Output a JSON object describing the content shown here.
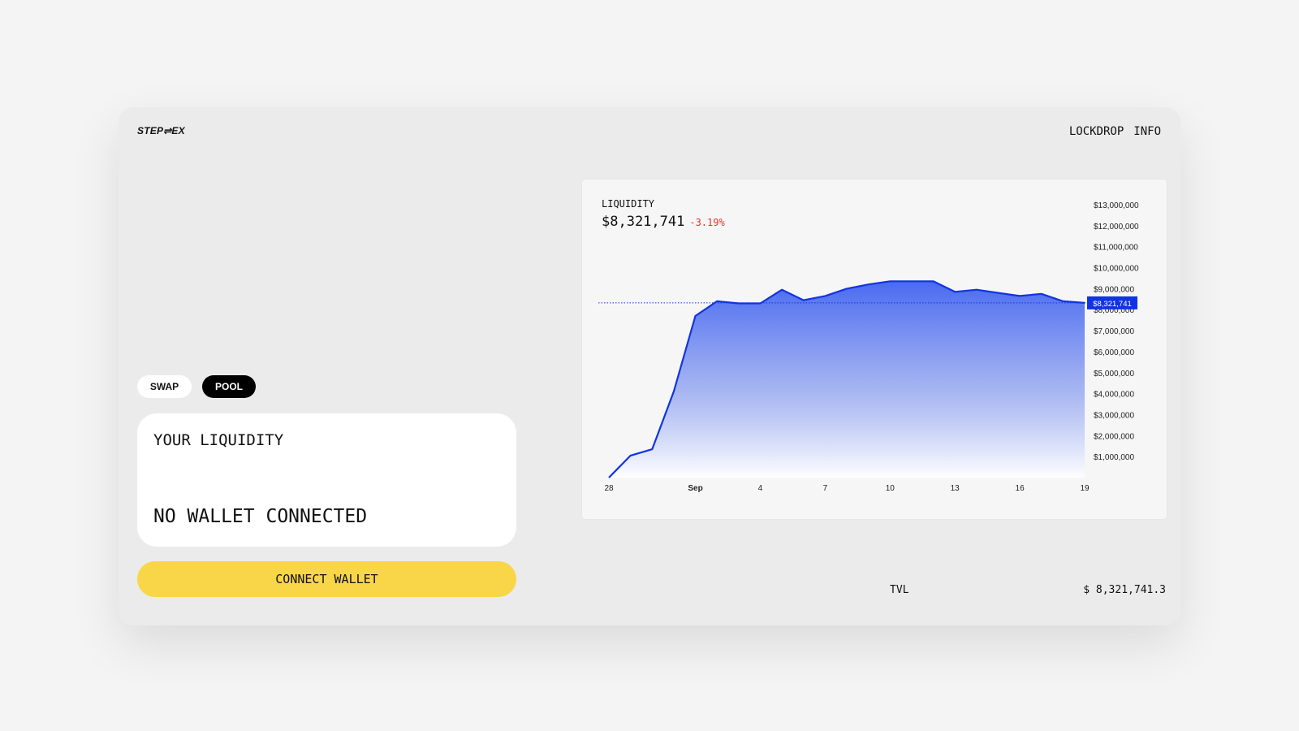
{
  "app": {
    "logo": "STEP⇌EX"
  },
  "nav": {
    "items": [
      "LOCKDROP",
      "INFO"
    ]
  },
  "tabs": {
    "swap": "SWAP",
    "pool": "POOL"
  },
  "liquidity_card": {
    "title": "YOUR LIQUIDITY",
    "status": "NO WALLET CONNECTED"
  },
  "connect_button": "CONNECT WALLET",
  "chart_panel": {
    "label": "LIQUIDITY",
    "value": "$8,321,741",
    "change": "-3.19%",
    "current_tag": "$8,321,741"
  },
  "tvl": {
    "label": "TVL",
    "value": "$ 8,321,741.3"
  },
  "colors": {
    "accent_yellow": "#f8d648",
    "line_blue": "#1134e0",
    "negative_red": "#e5322d"
  },
  "chart_data": {
    "type": "area",
    "x_tick_labels": [
      "28",
      "Sep",
      "4",
      "7",
      "10",
      "13",
      "16",
      "19"
    ],
    "x_tick_days": [
      -4,
      0,
      3,
      6,
      9,
      12,
      15,
      18
    ],
    "x_day": [
      -4,
      -3,
      -2,
      -1,
      0,
      1,
      2,
      3,
      4,
      5,
      6,
      7,
      8,
      9,
      10,
      11,
      12,
      13,
      14,
      15,
      16,
      17,
      18
    ],
    "values": [
      0,
      1050000,
      1350000,
      4100000,
      7700000,
      8400000,
      8300000,
      8300000,
      8950000,
      8450000,
      8650000,
      9000000,
      9200000,
      9350000,
      9350000,
      9350000,
      8850000,
      8950000,
      8800000,
      8650000,
      8750000,
      8400000,
      8321741
    ],
    "y_ticks": [
      "$1,000,000",
      "$2,000,000",
      "$3,000,000",
      "$4,000,000",
      "$5,000,000",
      "$6,000,000",
      "$7,000,000",
      "$8,000,000",
      "$9,000,000",
      "$10,000,000",
      "$11,000,000",
      "$12,000,000",
      "$13,000,000"
    ],
    "y_tick_values": [
      1000000,
      2000000,
      3000000,
      4000000,
      5000000,
      6000000,
      7000000,
      8000000,
      9000000,
      10000000,
      11000000,
      12000000,
      13000000
    ],
    "ylim": [
      0,
      13000000
    ],
    "current_value": 8321741,
    "grid": false
  }
}
